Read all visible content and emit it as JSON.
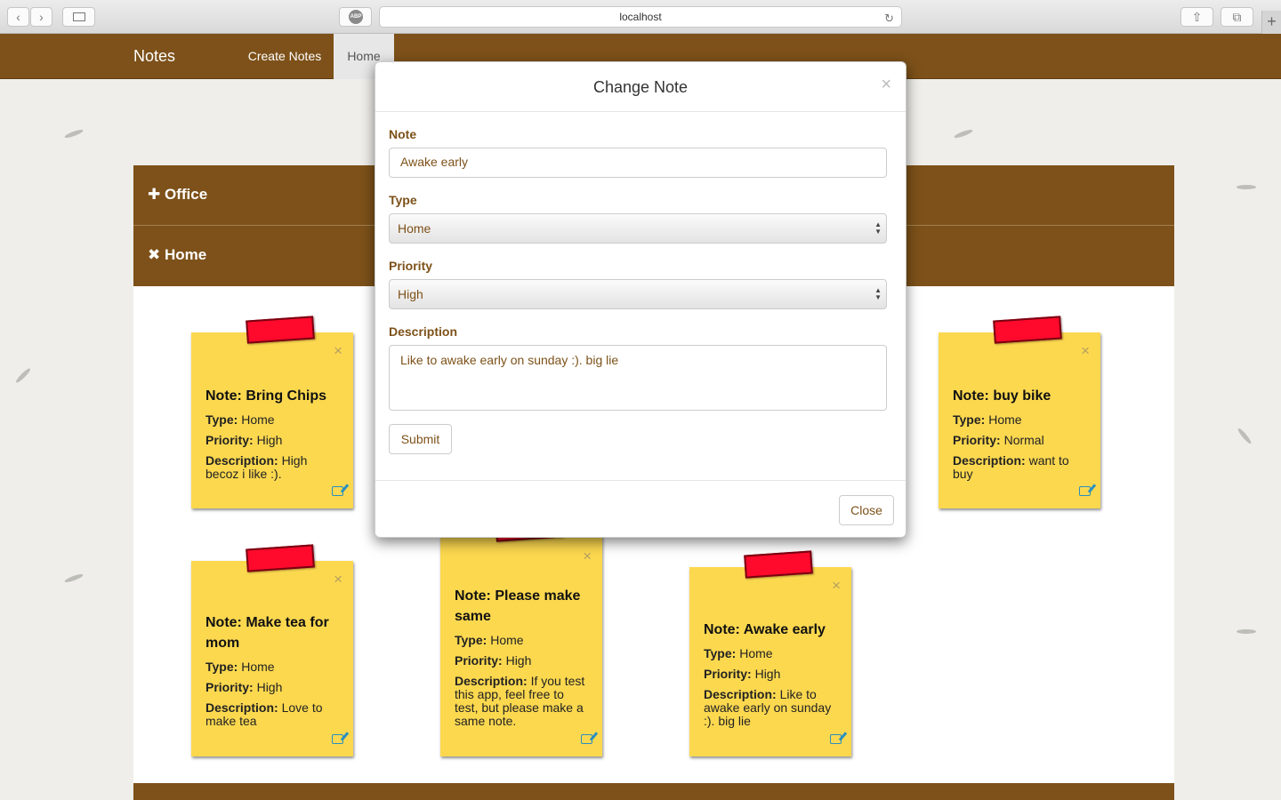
{
  "browser": {
    "url": "localhost",
    "abp": "ABP"
  },
  "nav": {
    "brand": "Notes",
    "create": "Create Notes",
    "home": "Home"
  },
  "panels": {
    "office": "Office",
    "home": "Home"
  },
  "notes": [
    {
      "title": "Note: Bring Chips",
      "type": "Home",
      "priority": "High",
      "description": "High becoz i like :)."
    },
    {
      "title": "Note: buy bike",
      "type": "Home",
      "priority": "Normal",
      "description": "want to buy"
    },
    {
      "title": "Note: Make tea for mom",
      "type": "Home",
      "priority": "High",
      "description": "Love to make tea"
    },
    {
      "title": "Note: Please make same",
      "type": "Home",
      "priority": "High",
      "description": "If you test this app, feel free to test, but please make a same note."
    },
    {
      "title": "Note: Awake early",
      "type": "Home",
      "priority": "High",
      "description": "Like to awake early on sunday :). big lie"
    }
  ],
  "labels": {
    "type": "Type:",
    "priority": "Priority:",
    "description": "Description:"
  },
  "modal": {
    "title": "Change Note",
    "note_label": "Note",
    "note_value": "Awake early",
    "type_label": "Type",
    "type_value": "Home",
    "priority_label": "Priority",
    "priority_value": "High",
    "description_label": "Description",
    "description_value": "Like to awake early on sunday :). big lie",
    "submit": "Submit",
    "close": "Close"
  }
}
